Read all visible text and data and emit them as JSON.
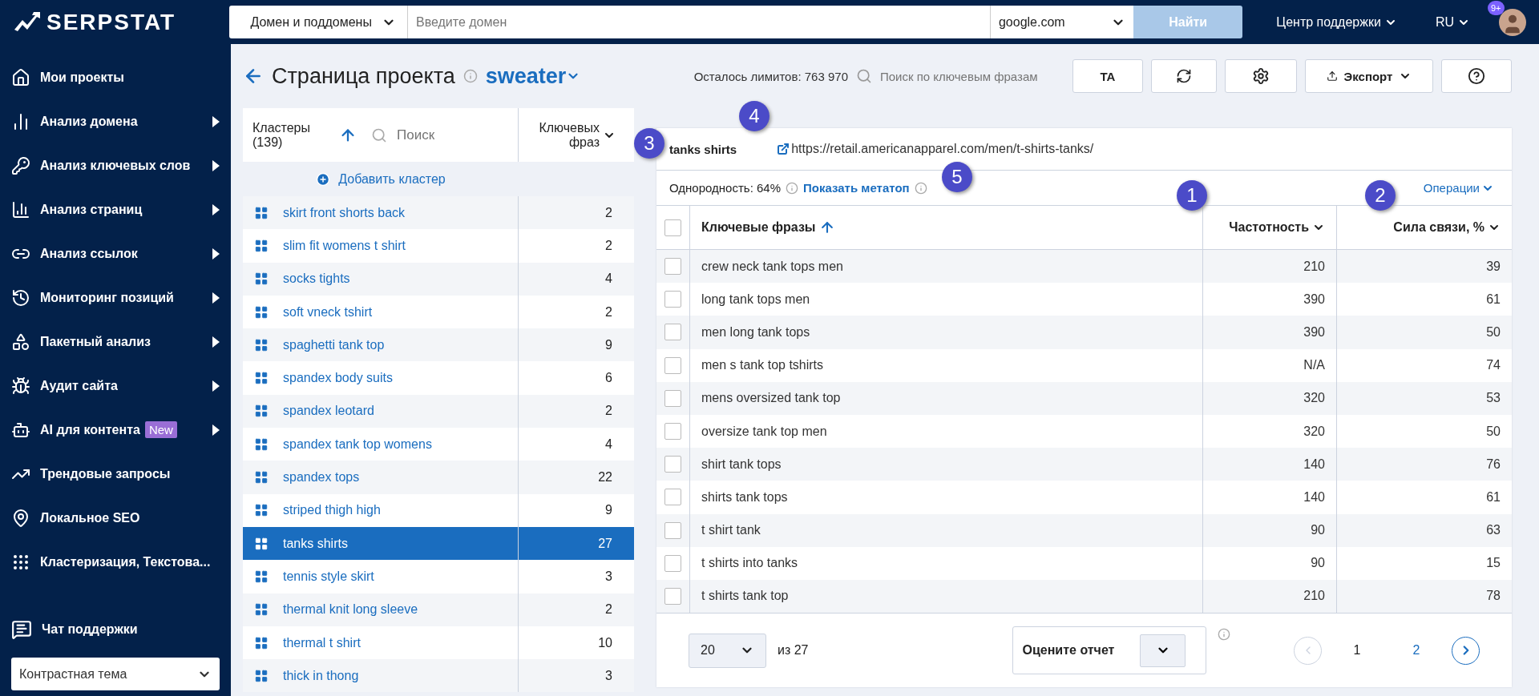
{
  "brand": {
    "name": "SERPSTAT"
  },
  "search": {
    "scope": "Домен и поддомены",
    "placeholder": "Введите домен",
    "engine": "google.com",
    "submit": "Найти"
  },
  "header": {
    "support": "Центр поддержки",
    "language": "RU",
    "notifications": "9+"
  },
  "sidebar": {
    "items": [
      {
        "label": "Мои проекты",
        "submenu": false
      },
      {
        "label": "Анализ домена",
        "submenu": true
      },
      {
        "label": "Анализ ключевых слов",
        "submenu": true
      },
      {
        "label": "Анализ страниц",
        "submenu": true
      },
      {
        "label": "Анализ ссылок",
        "submenu": true
      },
      {
        "label": "Мониторинг позиций",
        "submenu": true
      },
      {
        "label": "Пакетный анализ",
        "submenu": true
      },
      {
        "label": "Аудит сайта",
        "submenu": true
      },
      {
        "label": "AI для контента",
        "submenu": true,
        "badge": "New"
      },
      {
        "label": "Трендовые запросы",
        "submenu": false
      },
      {
        "label": "Локальное SEO",
        "submenu": false
      },
      {
        "label": "Кластеризация, Текстова...",
        "submenu": false
      }
    ],
    "chat": "Чат поддержки",
    "theme": "Контрастная тема"
  },
  "page": {
    "title": "Страница проекта",
    "project": "sweater",
    "limits": "Осталось лимитов: 763 970",
    "keyword_search_placeholder": "Поиск по ключевым фразам",
    "ta": "TA",
    "export": "Экспорт"
  },
  "clusters": {
    "title": "Кластеры (139)",
    "search_placeholder": "Поиск",
    "count_header": "Ключевых фраз",
    "add": "Добавить кластер",
    "items": [
      {
        "name": "skirt front shorts back",
        "count": "2",
        "selected": false
      },
      {
        "name": "slim fit womens t shirt",
        "count": "2",
        "selected": false
      },
      {
        "name": "socks tights",
        "count": "4",
        "selected": false
      },
      {
        "name": "soft vneck tshirt",
        "count": "2",
        "selected": false
      },
      {
        "name": "spaghetti tank top",
        "count": "9",
        "selected": false
      },
      {
        "name": "spandex body suits",
        "count": "6",
        "selected": false
      },
      {
        "name": "spandex leotard",
        "count": "2",
        "selected": false
      },
      {
        "name": "spandex tank top womens",
        "count": "4",
        "selected": false
      },
      {
        "name": "spandex tops",
        "count": "22",
        "selected": false
      },
      {
        "name": "striped thigh high",
        "count": "9",
        "selected": false
      },
      {
        "name": "tanks shirts",
        "count": "27",
        "selected": true
      },
      {
        "name": "tennis style skirt",
        "count": "3",
        "selected": false
      },
      {
        "name": "thermal knit long sleeve",
        "count": "2",
        "selected": false
      },
      {
        "name": "thermal t shirt",
        "count": "10",
        "selected": false
      },
      {
        "name": "thick in thong",
        "count": "3",
        "selected": false
      }
    ]
  },
  "cluster_detail": {
    "name": "tanks shirts",
    "url": "https://retail.americanapparel.com/men/t-shirts-tanks/",
    "homogeneity": "Однородность: 64%",
    "metatop": "Показать метатоп",
    "operations": "Операции",
    "columns": [
      "Ключевые фразы",
      "Частотность",
      "Сила связи, %"
    ],
    "all_checked": false,
    "rows": [
      {
        "phrase": "crew neck tank tops men",
        "frequency": "210",
        "strength": "39",
        "checked": false
      },
      {
        "phrase": "long tank tops men",
        "frequency": "390",
        "strength": "61",
        "checked": false
      },
      {
        "phrase": "men long tank tops",
        "frequency": "390",
        "strength": "50",
        "checked": false
      },
      {
        "phrase": "men s tank top tshirts",
        "frequency": "N/A",
        "strength": "74",
        "checked": false
      },
      {
        "phrase": "mens oversized tank top",
        "frequency": "320",
        "strength": "53",
        "checked": false
      },
      {
        "phrase": "oversize tank top men",
        "frequency": "320",
        "strength": "50",
        "checked": false
      },
      {
        "phrase": "shirt tank tops",
        "frequency": "140",
        "strength": "76",
        "checked": false
      },
      {
        "phrase": "shirts tank tops",
        "frequency": "140",
        "strength": "61",
        "checked": false
      },
      {
        "phrase": "t shirt tank",
        "frequency": "90",
        "strength": "63",
        "checked": false
      },
      {
        "phrase": "t shirts into tanks",
        "frequency": "90",
        "strength": "15",
        "checked": false
      },
      {
        "phrase": "t shirts tank top",
        "frequency": "210",
        "strength": "78",
        "checked": false
      }
    ],
    "footer": {
      "page_size": "20",
      "total": "из 27",
      "rate": "Оцените отчет",
      "pages": [
        {
          "label": "1",
          "selected": true
        },
        {
          "label": "2",
          "selected": false
        }
      ]
    }
  },
  "markers": [
    {
      "label": "1"
    },
    {
      "label": "2"
    },
    {
      "label": "3"
    },
    {
      "label": "4"
    },
    {
      "label": "5"
    }
  ]
}
